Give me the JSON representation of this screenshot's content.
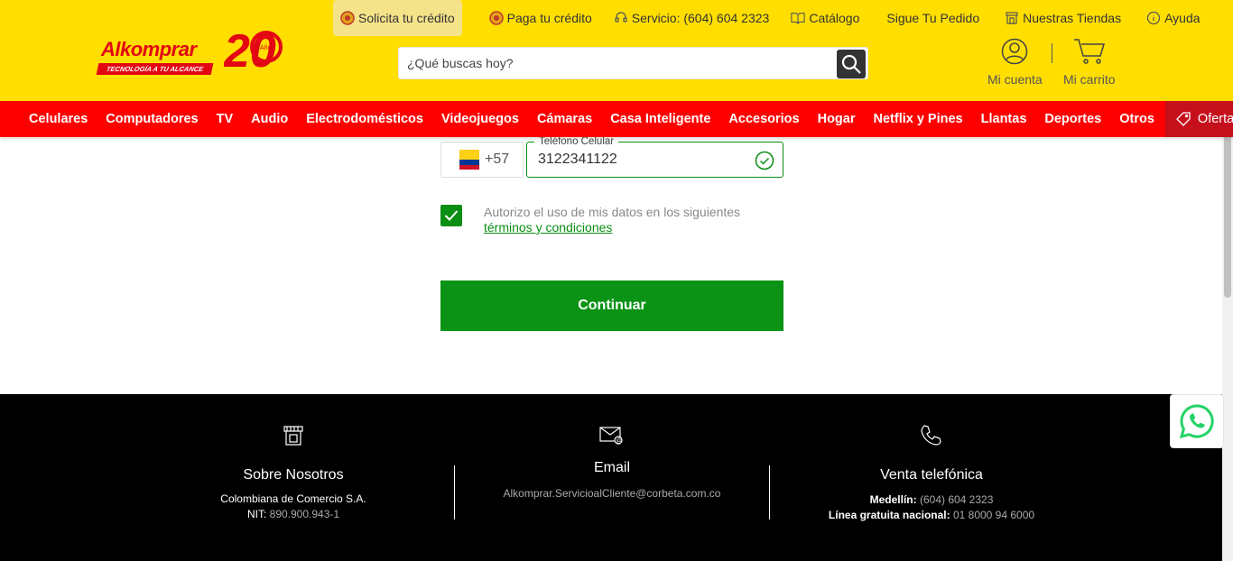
{
  "brand": {
    "name": "Alkomprar",
    "tagline": "TECNOLOGÍA A TU ALCANCE",
    "anniversary_number": "20",
    "anniversary_label": "Años"
  },
  "topbar": {
    "credit_request": "Solicita tu crédito",
    "pay_credit": "Paga tu crédito",
    "service": "Servicio: (604) 604 2323",
    "catalog": "Catálogo",
    "track_order": "Sigue Tu Pedido",
    "stores": "Nuestras Tiendas",
    "help": "Ayuda"
  },
  "search": {
    "placeholder": "¿Qué buscas hoy?"
  },
  "account": {
    "my_account": "Mi cuenta",
    "my_cart": "Mi carrito"
  },
  "nav": {
    "items": [
      "Celulares",
      "Computadores",
      "TV",
      "Audio",
      "Electrodomésticos",
      "Videojuegos",
      "Cámaras",
      "Casa Inteligente",
      "Accesorios",
      "Hogar",
      "Netflix y Pines",
      "Llantas",
      "Deportes",
      "Otros"
    ],
    "offers": "Ofertas"
  },
  "form": {
    "country_code": "+57",
    "phone_label": "Teléfono Celular",
    "phone_value": "3122341122",
    "consent_text": "Autorizo el uso de mis datos en los siguientes",
    "consent_link": "términos y condiciones",
    "continue_label": "Continuar"
  },
  "footer": {
    "about": {
      "title": "Sobre Nosotros",
      "company": "Colombiana de Comercio S.A.",
      "nit_label": "NIT:",
      "nit_value": "890.900.943-1"
    },
    "email": {
      "title": "Email",
      "address": "Alkomprar.ServicioalCliente@corbeta.com.co"
    },
    "phone_sales": {
      "title": "Venta telefónica",
      "medellin_label": "Medellín:",
      "medellin_value": "(604) 604 2323",
      "national_label": "Línea gratuita nacional:",
      "national_value": "01 8000 94 6000"
    }
  },
  "colors": {
    "header_yellow": "#ffde00",
    "nav_red": "#ff0000",
    "brand_red": "#e30613",
    "success_green": "#0a9314",
    "footer_black": "#000000"
  }
}
